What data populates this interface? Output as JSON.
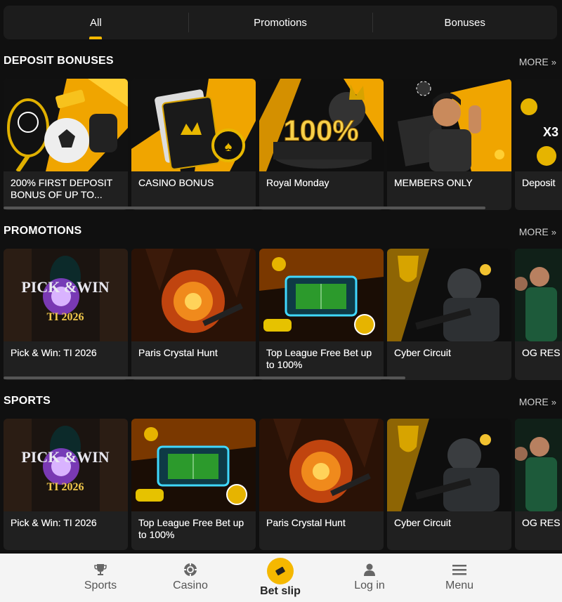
{
  "tabs": [
    {
      "label": "All",
      "active": true
    },
    {
      "label": "Promotions",
      "active": false
    },
    {
      "label": "Bonuses",
      "active": false
    }
  ],
  "more_label": "MORE",
  "sections": {
    "deposit": {
      "title": "DEPOSIT BONUSES",
      "cards": [
        {
          "label": "200% FIRST DEPOSIT BONUS OF UP TO..."
        },
        {
          "label": "CASINO BONUS"
        },
        {
          "label": "Royal Monday",
          "image_text": "100%"
        },
        {
          "label": "MEMBERS ONLY"
        },
        {
          "label": "Deposit"
        }
      ]
    },
    "promotions": {
      "title": "PROMOTIONS",
      "cards": [
        {
          "label": "Pick & Win: TI 2026",
          "image_text": "PICK &WIN",
          "image_sub": "TI 2026"
        },
        {
          "label": "Paris Crystal Hunt"
        },
        {
          "label": "Top League Free Bet up to 100%"
        },
        {
          "label": "Cyber Circuit"
        },
        {
          "label": "OG RES REWAR"
        }
      ]
    },
    "sports": {
      "title": "SPORTS",
      "cards": [
        {
          "label": "Pick & Win: TI 2026",
          "image_text": "PICK &WIN",
          "image_sub": "TI 2026"
        },
        {
          "label": "Top League Free Bet up to 100%"
        },
        {
          "label": "Paris Crystal Hunt"
        },
        {
          "label": "Cyber Circuit"
        },
        {
          "label": "OG RES REWAR"
        }
      ]
    }
  },
  "bottom_nav": {
    "sports": "Sports",
    "casino": "Casino",
    "betslip": "Bet slip",
    "login": "Log in",
    "menu": "Menu"
  },
  "colors": {
    "accent": "#f5b800",
    "background": "#101010",
    "card": "#202020"
  }
}
